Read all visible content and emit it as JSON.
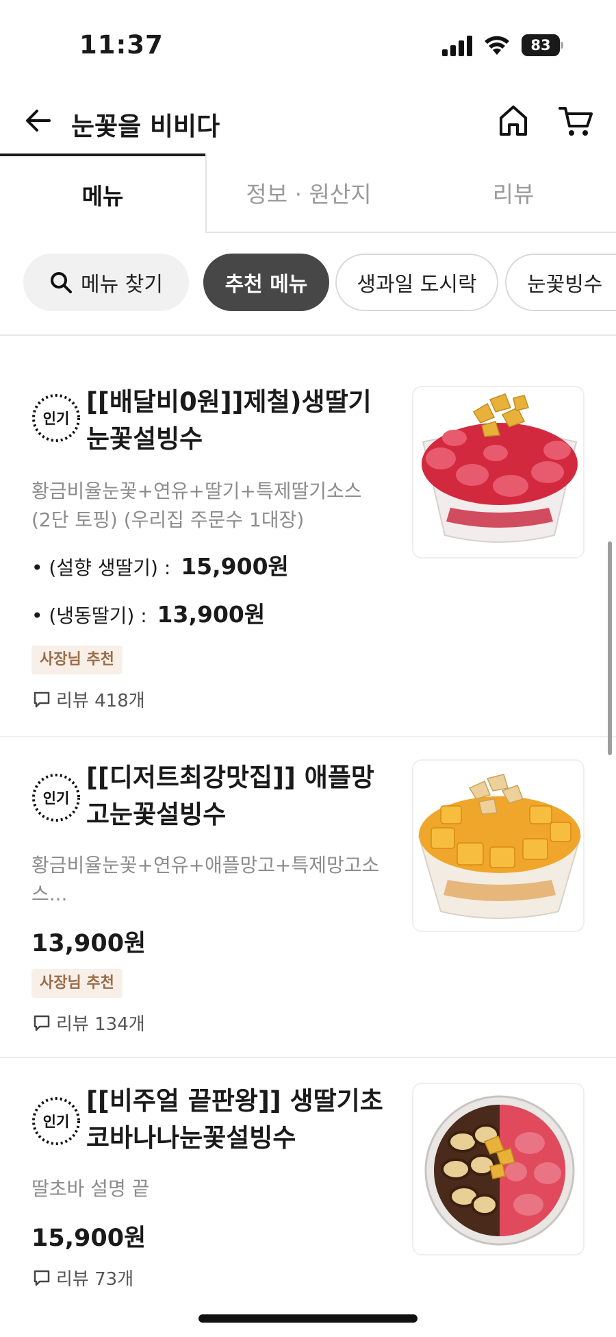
{
  "status_bar": {
    "time": "11:37",
    "battery": "83"
  },
  "header": {
    "title": "눈꽃을 비비다"
  },
  "tabs": [
    {
      "label": "메뉴",
      "active": true
    },
    {
      "label": "정보 · 원산지",
      "active": false
    },
    {
      "label": "리뷰",
      "active": false
    }
  ],
  "chips": {
    "search": "메뉴 찾기",
    "items": [
      "추천 메뉴",
      "생과일 도시락",
      "눈꽃빙수"
    ],
    "active": "추천 메뉴"
  },
  "menu_items": [
    {
      "badge": "인기",
      "name": "[[배달비0원]]제철)생딸기 눈꽃설빙수",
      "description": "황금비율눈꽃+연유+딸기+특제딸기소스 (2단 토핑) (우리집 주문수 1대장)",
      "options": [
        {
          "label": "• (설향 생딸기) :",
          "price": "15,900원"
        },
        {
          "label": "• (냉동딸기) :",
          "price": "13,900원"
        }
      ],
      "tag": "사장님 추천",
      "reviews": "리뷰 418개",
      "image": "strawberry-bingsu"
    },
    {
      "badge": "인기",
      "name": "[[디저트최강맛집]] 애플망고눈꽃설빙수",
      "description": "황금비율눈꽃+연유+애플망고+특제망고소스...",
      "price": "13,900원",
      "tag": "사장님 추천",
      "reviews": "리뷰 134개",
      "image": "mango-bingsu"
    },
    {
      "badge": "인기",
      "name": "[[비주얼 끝판왕]] 생딸기초코바나나눈꽃설빙수",
      "description": "딸초바 설명 끝",
      "price": "15,900원",
      "reviews": "리뷰 73개",
      "image": "choco-banana-strawberry-bingsu"
    }
  ],
  "colors": {
    "active_chip": "#474747",
    "tag_bg": "#f7efe8",
    "tag_text": "#9b6b47"
  }
}
